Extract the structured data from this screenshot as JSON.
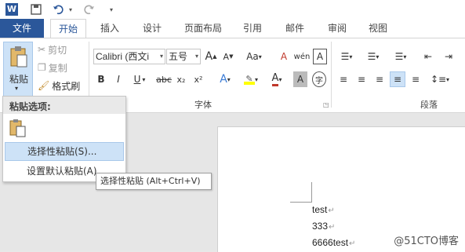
{
  "qat": {
    "app_icon": "W"
  },
  "tabs": [
    "文件",
    "开始",
    "插入",
    "设计",
    "页面布局",
    "引用",
    "邮件",
    "审阅",
    "视图"
  ],
  "clipboard": {
    "paste_label": "粘贴",
    "cut_label": "剪切",
    "copy_label": "复制",
    "format_painter_label": "格式刷"
  },
  "font": {
    "name": "Calibri (西文i",
    "size": "五号",
    "group_label": "字体",
    "aa_label": "Aa",
    "bold": "B",
    "italic": "I",
    "underline": "U",
    "strike": "abc",
    "sub": "x₂",
    "sup": "x²",
    "grow": "A",
    "shrink": "A",
    "clear_format": "A",
    "char_border": "A",
    "wen": "wén",
    "text_effect": "A",
    "font_color": "A",
    "char_shading": "A",
    "enclose": "字"
  },
  "paragraph": {
    "group_label": "段落"
  },
  "paste_menu": {
    "header": "粘贴选项:",
    "items": [
      "选择性粘贴(S)...",
      "设置默认粘贴(A)..."
    ]
  },
  "tooltip": "选择性粘贴 (Alt+Ctrl+V)",
  "document": {
    "lines": [
      "test",
      "333",
      "6666test"
    ],
    "para_mark": "↵"
  },
  "watermark": "@51CTO博客",
  "colors": {
    "file_tab": "#2b579a",
    "accent": "#2b579a",
    "highlight": "#cde2f7"
  }
}
